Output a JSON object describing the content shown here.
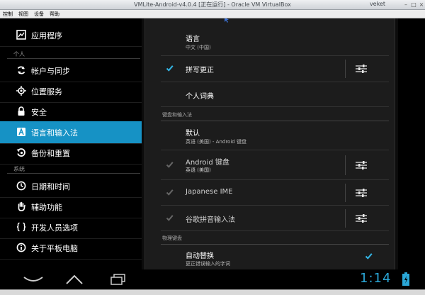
{
  "window": {
    "title": "VMLite-Android-v4.0.4 [正在运行] - Oracle VM VirtualBox",
    "user": "veket"
  },
  "host_menu": [
    "控制",
    "视图",
    "设备",
    "帮助"
  ],
  "left_pane": {
    "top_item": {
      "label": "应用程序",
      "icon": "apps-icon"
    },
    "personal_header": "个人",
    "personal_items": [
      {
        "label": "帐户与同步",
        "icon": "sync-icon"
      },
      {
        "label": "位置服务",
        "icon": "location-icon"
      },
      {
        "label": "安全",
        "icon": "lock-icon"
      },
      {
        "label": "语言和输入法",
        "icon": "keyboard-a-icon",
        "selected": true
      },
      {
        "label": "备份和重置",
        "icon": "backup-icon"
      }
    ],
    "system_header": "系统",
    "system_items": [
      {
        "label": "日期和时间",
        "icon": "clock-icon"
      },
      {
        "label": "辅助功能",
        "icon": "hand-icon"
      },
      {
        "label": "开发人员选项",
        "icon": "braces-icon"
      },
      {
        "label": "关于平板电脑",
        "icon": "info-icon"
      }
    ]
  },
  "right_pane": {
    "language": {
      "title": "语言",
      "summary": "中文 (中国)"
    },
    "spellcheck": {
      "title": "拼写更正",
      "checked": true
    },
    "dictionary": {
      "title": "个人词典"
    },
    "keyboard_header": "键盘和输入法",
    "default": {
      "title": "默认",
      "summary": "英语 (美国) - Android 键盘"
    },
    "android_kb": {
      "title": "Android 键盘",
      "summary": "英语 (美国)",
      "checked": true
    },
    "japanese_ime": {
      "title": "Japanese IME",
      "checked": true
    },
    "google_pinyin": {
      "title": "谷歌拼音输入法",
      "checked": true
    },
    "physical_header": "物理键盘",
    "auto_replace": {
      "title": "自动替换",
      "summary": "更正错误输入的字词",
      "checked": true
    }
  },
  "status": {
    "time": "1:14"
  },
  "colors": {
    "accent": "#1692c5",
    "clock": "#2aa6d6",
    "check": "#33b5e5"
  }
}
